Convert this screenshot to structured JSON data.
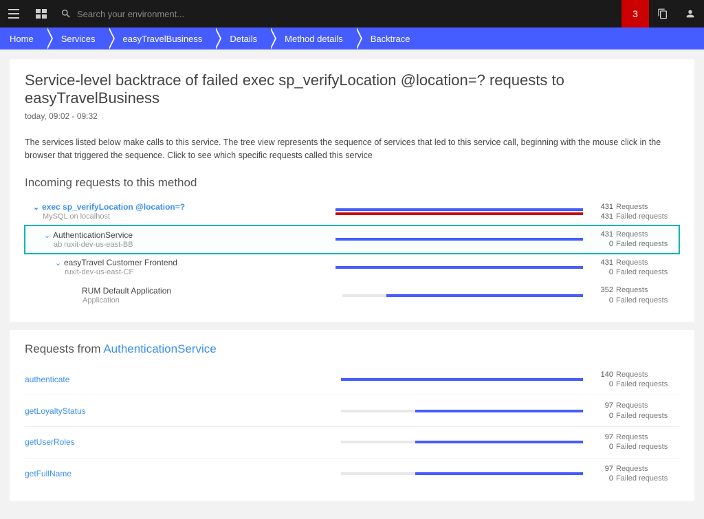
{
  "topbar": {
    "search_placeholder": "Search your environment...",
    "notifications": "3"
  },
  "breadcrumbs": [
    "Home",
    "Services",
    "easyTravelBusiness",
    "Details",
    "Method details",
    "Backtrace"
  ],
  "header": {
    "title": "Service-level backtrace of failed exec sp_verifyLocation @location=? requests to easyTravelBusiness",
    "timerange": "today, 09:02 - 09:32",
    "description": "The services listed below make calls to this service. The tree view represents the sequence of services that led to this service call, beginning with the mouse click in the browser that triggered the sequence. Click to see which specific requests called this service"
  },
  "incoming": {
    "heading": "Incoming requests to this method",
    "max": 431,
    "rows": [
      {
        "indent": 0,
        "prefix": "exec ",
        "title": "sp_verifyLocation @location=?",
        "sub": "MySQL on localhost",
        "req": 431,
        "failed": 431,
        "chev": true,
        "first": true,
        "highlighted": false
      },
      {
        "indent": 1,
        "prefix": "",
        "title": "AuthenticationService",
        "sub": "ab ruxit-dev-us-east-BB",
        "req": 431,
        "failed": 0,
        "chev": true,
        "first": false,
        "highlighted": true
      },
      {
        "indent": 2,
        "prefix": "",
        "title": "easyTravel Customer Frontend",
        "sub": "ruxit-dev-us-east-CF",
        "req": 431,
        "failed": 0,
        "chev": true,
        "first": false,
        "highlighted": false
      },
      {
        "indent": 3,
        "prefix": "",
        "title": "RUM Default Application",
        "sub": "Application",
        "req": 352,
        "failed": 0,
        "chev": false,
        "first": false,
        "highlighted": false
      }
    ]
  },
  "requests_from": {
    "heading_prefix": "Requests from ",
    "heading_service": "AuthenticationService",
    "max": 140,
    "rows": [
      {
        "name": "authenticate",
        "req": 140,
        "failed": 0
      },
      {
        "name": "getLoyaltyStatus",
        "req": 97,
        "failed": 0
      },
      {
        "name": "getUserRoles",
        "req": 97,
        "failed": 0
      },
      {
        "name": "getFullName",
        "req": 97,
        "failed": 0
      }
    ]
  },
  "labels": {
    "requests": "Requests",
    "failed": "Failed requests"
  }
}
